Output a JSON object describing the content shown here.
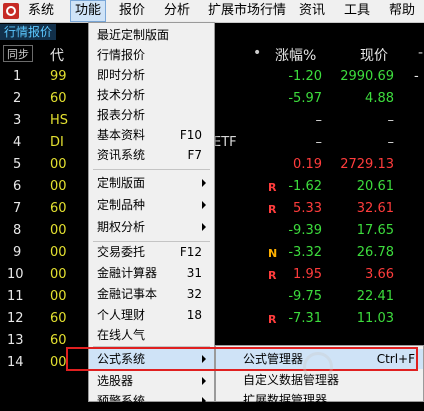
{
  "menubar": {
    "items": [
      {
        "label": "系统",
        "active": false
      },
      {
        "label": "功能",
        "active": true
      },
      {
        "label": "报价",
        "active": false
      },
      {
        "label": "分析",
        "active": false
      },
      {
        "label": "扩展市场行情",
        "active": false
      },
      {
        "label": "资讯",
        "active": false
      },
      {
        "label": "工具",
        "active": false
      },
      {
        "label": "帮助",
        "active": false
      }
    ]
  },
  "subbar": {
    "tab_label": "行情报价"
  },
  "table": {
    "sync_label": "同步",
    "headers": {
      "code": "代",
      "dot": "•",
      "change_pct": "涨幅%",
      "price": "现价",
      "cut": "-"
    },
    "rows": [
      {
        "num": "1",
        "code": "99",
        "extra": "",
        "flag": "",
        "change": "-1.20",
        "change_color": "#3ddc3d",
        "price": "2990.69",
        "price_color": "#3ddc3d",
        "cut": "-"
      },
      {
        "num": "2",
        "code": "60",
        "extra": "",
        "flag": "",
        "change": "-5.97",
        "change_color": "#3ddc3d",
        "price": "4.88",
        "price_color": "#3ddc3d",
        "cut": ""
      },
      {
        "num": "3",
        "code": "HS",
        "extra": "",
        "flag": "",
        "change": "–",
        "change_color": "#d8d8d8",
        "price": "–",
        "price_color": "#d8d8d8",
        "cut": ""
      },
      {
        "num": "4",
        "code": "DI",
        "extra": "ETF",
        "flag": "",
        "change": "–",
        "change_color": "#d8d8d8",
        "price": "–",
        "price_color": "#d8d8d8",
        "cut": ""
      },
      {
        "num": "5",
        "code": "00",
        "extra": "",
        "flag": "",
        "change": "0.19",
        "change_color": "#ff3c3c",
        "price": "2729.13",
        "price_color": "#ff3c3c",
        "cut": ""
      },
      {
        "num": "6",
        "code": "00",
        "extra": "",
        "flag": "R",
        "change": "-1.62",
        "change_color": "#3ddc3d",
        "price": "20.61",
        "price_color": "#3ddc3d",
        "cut": ""
      },
      {
        "num": "7",
        "code": "60",
        "extra": "",
        "flag": "R",
        "change": "5.33",
        "change_color": "#ff3c3c",
        "price": "32.61",
        "price_color": "#ff3c3c",
        "cut": ""
      },
      {
        "num": "8",
        "code": "00",
        "extra": "",
        "flag": "",
        "change": "-9.39",
        "change_color": "#3ddc3d",
        "price": "17.65",
        "price_color": "#3ddc3d",
        "cut": ""
      },
      {
        "num": "9",
        "code": "00",
        "extra": "",
        "flag": "N",
        "change": "-3.32",
        "change_color": "#3ddc3d",
        "price": "26.78",
        "price_color": "#3ddc3d",
        "cut": ""
      },
      {
        "num": "10",
        "code": "00",
        "extra": "",
        "flag": "R",
        "change": "1.95",
        "change_color": "#ff3c3c",
        "price": "3.66",
        "price_color": "#ff3c3c",
        "cut": ""
      },
      {
        "num": "11",
        "code": "00",
        "extra": "",
        "flag": "",
        "change": "-9.75",
        "change_color": "#3ddc3d",
        "price": "22.41",
        "price_color": "#3ddc3d",
        "cut": ""
      },
      {
        "num": "12",
        "code": "60",
        "extra": "",
        "flag": "R",
        "change": "-7.31",
        "change_color": "#3ddc3d",
        "price": "11.03",
        "price_color": "#3ddc3d",
        "cut": ""
      },
      {
        "num": "13",
        "code": "60",
        "extra": "",
        "flag": "",
        "change": "",
        "change_color": "#d8d8d8",
        "price": "",
        "price_color": "#d8d8d8",
        "cut": ""
      },
      {
        "num": "14",
        "code": "00",
        "extra": "",
        "flag": "",
        "change": "",
        "change_color": "#d8d8d8",
        "price": "",
        "price_color": "#d8d8d8",
        "cut": ""
      }
    ]
  },
  "dropdown": {
    "items": [
      {
        "label": "最近定制版面",
        "shortcut": "",
        "submenu": false
      },
      {
        "label": "行情报价",
        "shortcut": "",
        "submenu": false
      },
      {
        "label": "即时分析",
        "shortcut": "",
        "submenu": false
      },
      {
        "label": "技术分析",
        "shortcut": "",
        "submenu": false
      },
      {
        "label": "报表分析",
        "shortcut": "",
        "submenu": false
      },
      {
        "label": "基本资料",
        "shortcut": "F10",
        "submenu": false
      },
      {
        "label": "资讯系统",
        "shortcut": "F7",
        "submenu": false
      },
      {
        "label": "定制版面",
        "shortcut": "",
        "submenu": true
      },
      {
        "label": "定制品种",
        "shortcut": "",
        "submenu": true
      },
      {
        "label": "期权分析",
        "shortcut": "",
        "submenu": true
      },
      {
        "label": "交易委托",
        "shortcut": "F12",
        "submenu": false
      },
      {
        "label": "金融计算器",
        "shortcut": "31",
        "submenu": false
      },
      {
        "label": "金融记事本",
        "shortcut": "32",
        "submenu": false
      },
      {
        "label": "个人理财",
        "shortcut": "18",
        "submenu": false
      },
      {
        "label": "在线人气",
        "shortcut": "",
        "submenu": false
      },
      {
        "label": "公式系统",
        "shortcut": "",
        "submenu": true
      },
      {
        "label": "选股器",
        "shortcut": "",
        "submenu": true
      },
      {
        "label": "预警系统",
        "shortcut": "",
        "submenu": true
      }
    ]
  },
  "submenu": {
    "items": [
      {
        "label": "公式管理器",
        "shortcut": "Ctrl+F"
      },
      {
        "label": "自定义数据管理器",
        "shortcut": ""
      },
      {
        "label": "扩展数据管理器",
        "shortcut": ""
      }
    ]
  },
  "colors": {
    "highlight_frame": "#e02020",
    "menu_highlight": "#cfe3f7"
  }
}
